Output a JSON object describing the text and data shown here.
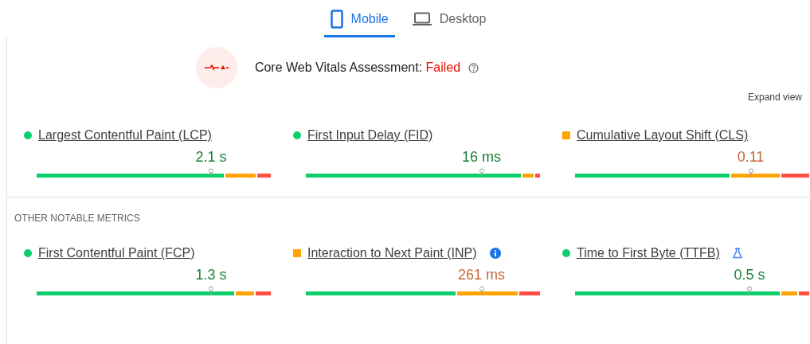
{
  "tabs": [
    {
      "label": "Mobile",
      "selected": true
    },
    {
      "label": "Desktop",
      "selected": false
    }
  ],
  "assessment": {
    "label": "Core Web Vitals Assessment: ",
    "result": "Failed"
  },
  "expand_link": "Expand view",
  "core_metrics": [
    {
      "name": "Largest Contentful Paint (LCP)",
      "color": "#0cce6b",
      "value": "2.1 s"
    },
    {
      "name": "First Input Delay (FID)",
      "color": "#0cce6b",
      "value": "16 ms"
    },
    {
      "name": "Cumulative Layout Shift (CLS)",
      "color": "#ffa400",
      "value": "0.11"
    }
  ],
  "other_heading": "OTHER NOTABLE METRICS",
  "other_metrics": [
    {
      "name": "First Contentful Paint (FCP)",
      "color": "#0cce6b",
      "value": "1.3 s"
    },
    {
      "name": "Interaction to Next Paint (INP)",
      "color": "#ffa400",
      "value": "261 ms"
    },
    {
      "name": "Time to First Byte (TTFB)",
      "color": "#0cce6b",
      "value": "0.5 s"
    }
  ]
}
